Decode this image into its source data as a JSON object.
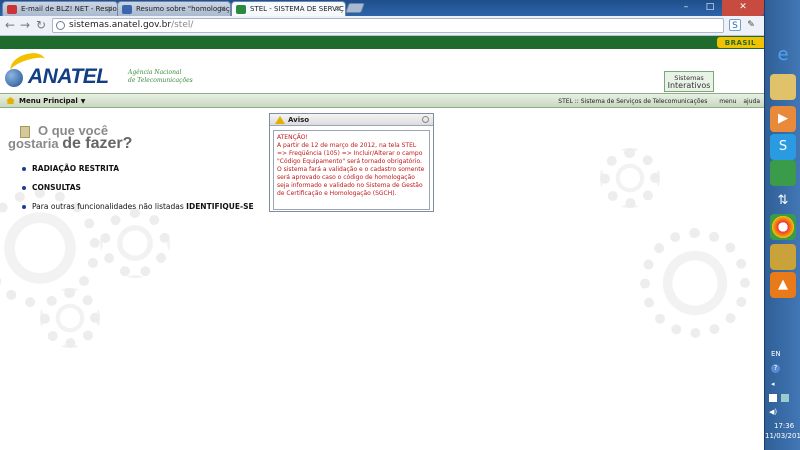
{
  "browser": {
    "tabs": [
      {
        "title": "E-mail de BLZ! NET - Respo",
        "close": "×",
        "favicon_color": "#c33"
      },
      {
        "title": "Resumo sobre \"homologaç",
        "close": "×",
        "favicon_color": "#3a66b0"
      },
      {
        "title": "STEL - SISTEMA DE SERVIÇ",
        "close": "×",
        "favicon_color": "#2b8a3e"
      }
    ],
    "url_host": "sistemas.anatel.gov.br",
    "url_path": "/stel/",
    "back_icon": "←",
    "forward_icon": "→",
    "reload_icon": "↻",
    "star_icon": "☆",
    "window_controls": {
      "minimize": "–",
      "maximize": "□",
      "close": "✕"
    }
  },
  "gov_bar": {
    "label": "BRASIL"
  },
  "header": {
    "logo_text": "ANATEL",
    "logo_sub_line1": "Agência Nacional",
    "logo_sub_line2": "de Telecomunicações",
    "systems_button_line1": "Sistemas",
    "systems_button_line2": "Interativos"
  },
  "menubar": {
    "main_menu": "Menu Principal",
    "caret": "▼",
    "system_name": "STEL :: Sistema de Serviços de Telecomunicações",
    "menu_link": "menu",
    "help_link": "ajuda"
  },
  "main": {
    "question_line1": "O que você",
    "question_line2a": "gostaria ",
    "question_line2b": "de fazer?",
    "options": [
      {
        "label": "RADIAÇÃO RESTRITA"
      },
      {
        "label": "CONSULTAS"
      },
      {
        "prefix": "Para outras funcionalidades não listadas ",
        "link": "IDENTIFIQUE-SE"
      }
    ]
  },
  "aviso": {
    "title": "Aviso",
    "text": "ATENÇÃO!\nA partir de 12 de março de 2012, na tela STEL => Freqüência (105) => Incluir/Alterar o campo \"Código Equipamento\" será tornado obrigatório. O sistema fará a validação e o cadastro somente será aprovado caso o código de homologação seja informado e validado no Sistema de Gestão de Certificação e Homologação (SGCH)."
  },
  "taskbar": {
    "language": "EN",
    "time": "17:36",
    "date": "11/03/2012",
    "colors": {
      "sidebar": "#3a6ca8"
    }
  }
}
